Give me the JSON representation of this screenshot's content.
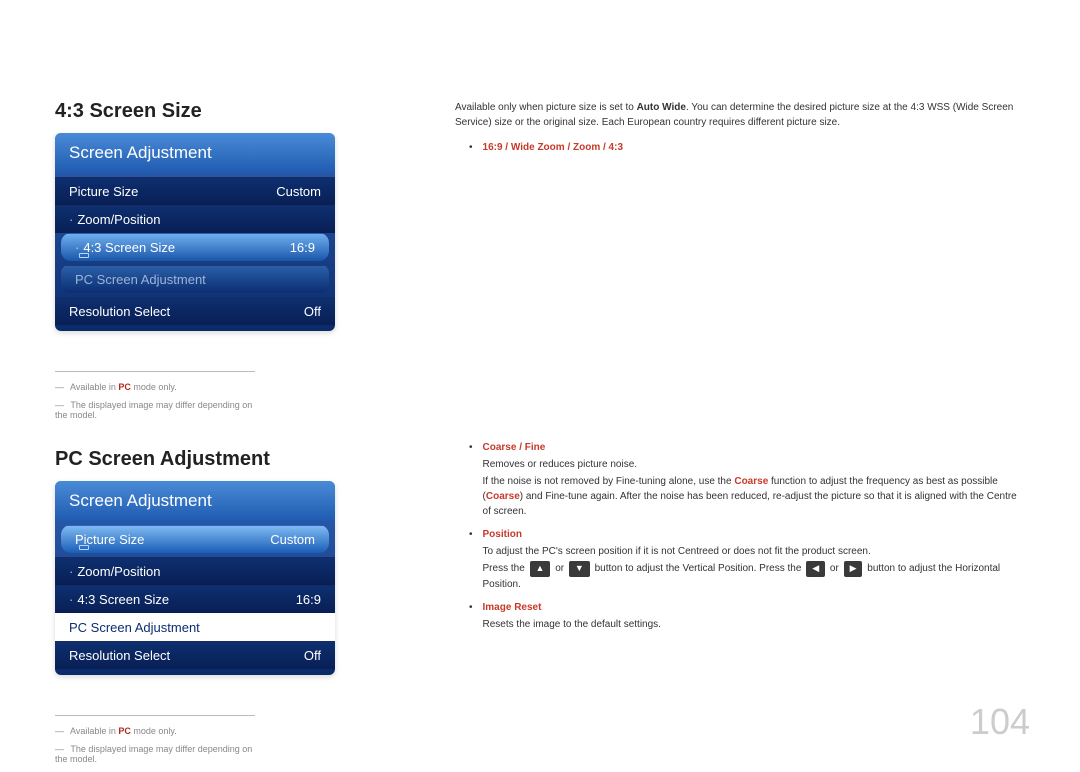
{
  "page_number": "104",
  "section1": {
    "heading": "4:3 Screen Size",
    "menu_title": "Screen Adjustment",
    "rows": {
      "picture_size_label": "Picture Size",
      "picture_size_value": "Custom",
      "zoom_position": "Zoom/Position",
      "screen_size_label": "4:3 Screen Size",
      "screen_size_value": "16:9",
      "pc_screen": "PC Screen Adjustment",
      "res_label": "Resolution Select",
      "res_value": "Off"
    },
    "notes": {
      "n1_pre": "Available in ",
      "n1_pc": "PC",
      "n1_post": " mode only.",
      "n2": "The displayed image may differ depending on the model."
    },
    "right": {
      "intro_pre": "Available only when picture size is set to ",
      "intro_bold": "Auto Wide",
      "intro_post": ". You can determine the desired picture size at the 4:3 WSS (Wide Screen Service) size or the original size. Each European country requires different picture size.",
      "options": "16:9 / Wide Zoom / Zoom / 4:3"
    }
  },
  "section2": {
    "heading": "PC Screen Adjustment",
    "menu_title": "Screen Adjustment",
    "rows": {
      "picture_size_label": "Picture Size",
      "picture_size_value": "Custom",
      "zoom_position": "Zoom/Position",
      "screen_size_label": "4:3 Screen Size",
      "screen_size_value": "16:9",
      "pc_screen": "PC Screen Adjustment",
      "res_label": "Resolution Select",
      "res_value": "Off"
    },
    "notes": {
      "n1_pre": "Available in ",
      "n1_pc": "PC",
      "n1_post": " mode only.",
      "n2": "The displayed image may differ depending on the model."
    },
    "right": {
      "coarse_fine": "Coarse / Fine",
      "coarse_fine_desc": "Removes or reduces picture noise.",
      "coarse_fine_detail_pre": "If the noise is not removed by Fine-tuning alone, use the ",
      "coarse_word": "Coarse",
      "coarse_fine_detail_mid": " function to adjust the frequency as best as possible (",
      "coarse_fine_detail_post": ") and Fine-tune again. After the noise has been reduced, re-adjust the picture so that it is aligned with the Centre of screen.",
      "position": "Position",
      "position_desc": "To adjust the PC's screen position if it is not Centreed or does not fit the product screen.",
      "position_press_pre": "Press the ",
      "position_press_mid": " button to adjust the Vertical Position. Press the ",
      "position_press_post": " button to adjust the Horizontal Position.",
      "position_or": " or ",
      "image_reset": "Image Reset",
      "image_reset_desc": "Resets the image to the default settings."
    }
  }
}
